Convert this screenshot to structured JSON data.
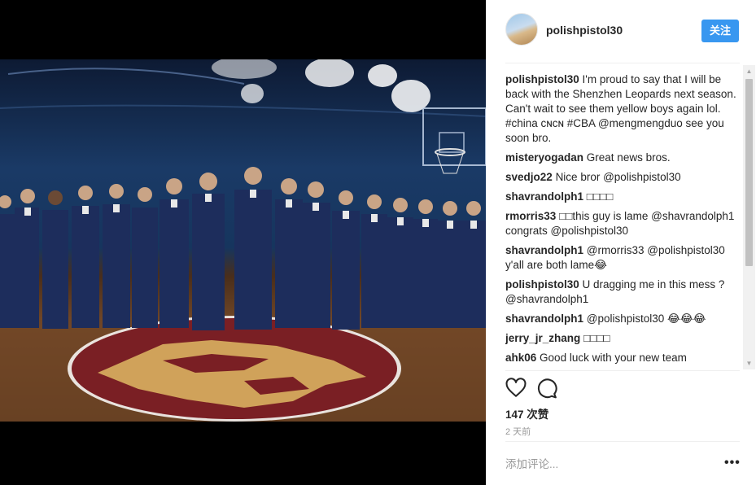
{
  "post": {
    "image_alt": "Shenzhen Leopards team photo"
  },
  "header": {
    "username": "polishpistol30",
    "follow_label": "关注"
  },
  "comments": [
    {
      "user": "polishpistol30",
      "text": "I'm proud to say that I will be back with the Shenzhen Leopards next season. Can't wait to see them yellow boys again lol. #china ᴄɴᴄɴ #CBA @mengmengduo see you soon bro."
    },
    {
      "user": "misteryogadan",
      "text": "Great news bros."
    },
    {
      "user": "svedjo22",
      "text": "Nice bror @polishpistol30"
    },
    {
      "user": "shavrandolph1",
      "text": "□□□□"
    },
    {
      "user": "rmorris33",
      "text": "□□this guy is lame @shavrandolph1 congrats @polishpistol30"
    },
    {
      "user": "shavrandolph1",
      "text": "@rmorris33 @polishpistol30 y'all are both lame😂"
    },
    {
      "user": "polishpistol30",
      "text": "U dragging me in this mess ? @shavrandolph1"
    },
    {
      "user": "shavrandolph1",
      "text": "@polishpistol30 😂😂😂"
    },
    {
      "user": "jerry_jr_zhang",
      "text": "□□□□"
    },
    {
      "user": "ahk06",
      "text": "Good luck with your new team"
    }
  ],
  "actions": {
    "like_icon": "heart-icon",
    "comment_icon": "comment-icon"
  },
  "likes": "147 次赞",
  "time": "2 天前",
  "add_comment": {
    "placeholder": "添加评论..."
  },
  "more_label": "•••"
}
